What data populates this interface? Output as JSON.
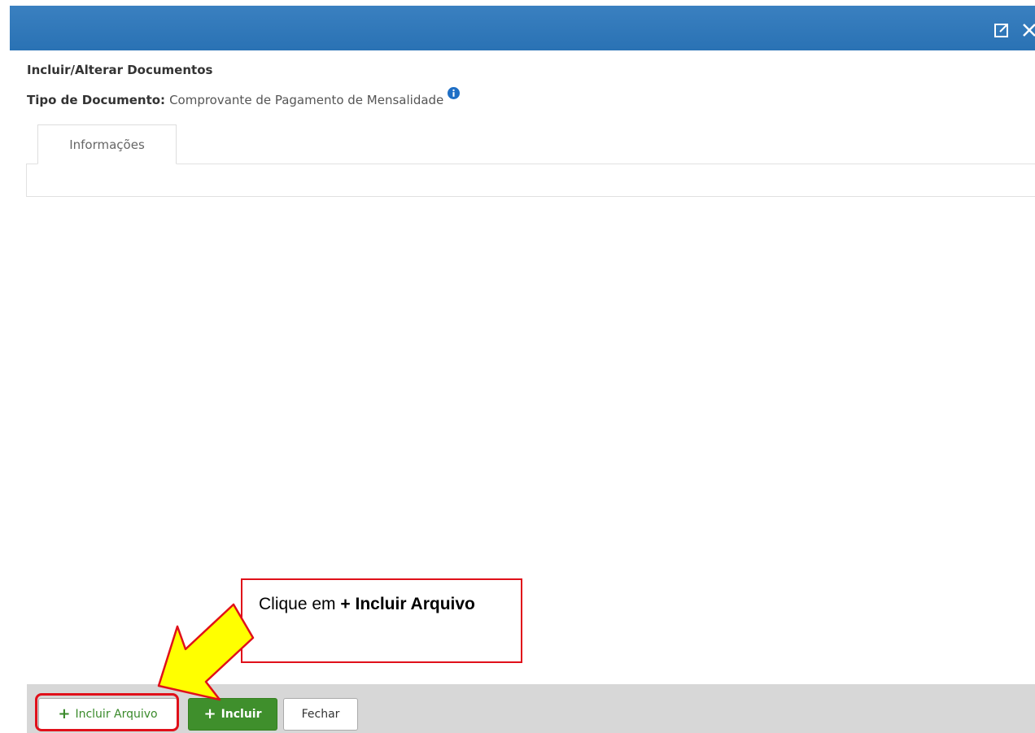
{
  "window": {
    "expand_icon": "open-in-new-icon",
    "close_icon": "close-icon",
    "titlebar_color": "#2a72b4"
  },
  "page": {
    "heading": "Incluir/Alterar Documentos",
    "document_type_label": "Tipo de Documento:",
    "document_type_value": "Comprovante de Pagamento de Mensalidade",
    "info_icon": "info-icon"
  },
  "tabs": [
    {
      "label": "Informações",
      "active": true
    }
  ],
  "footer": {
    "include_file_label": "Incluir Arquivo",
    "include_label": "Incluir",
    "close_label": "Fechar",
    "include_color": "#3f8f2c"
  },
  "annotation": {
    "callout_prefix": "Clique em",
    "callout_bold": "+ Incluir Arquivo",
    "arrow_color": "#ffff00",
    "highlight_color": "#e0101a"
  }
}
